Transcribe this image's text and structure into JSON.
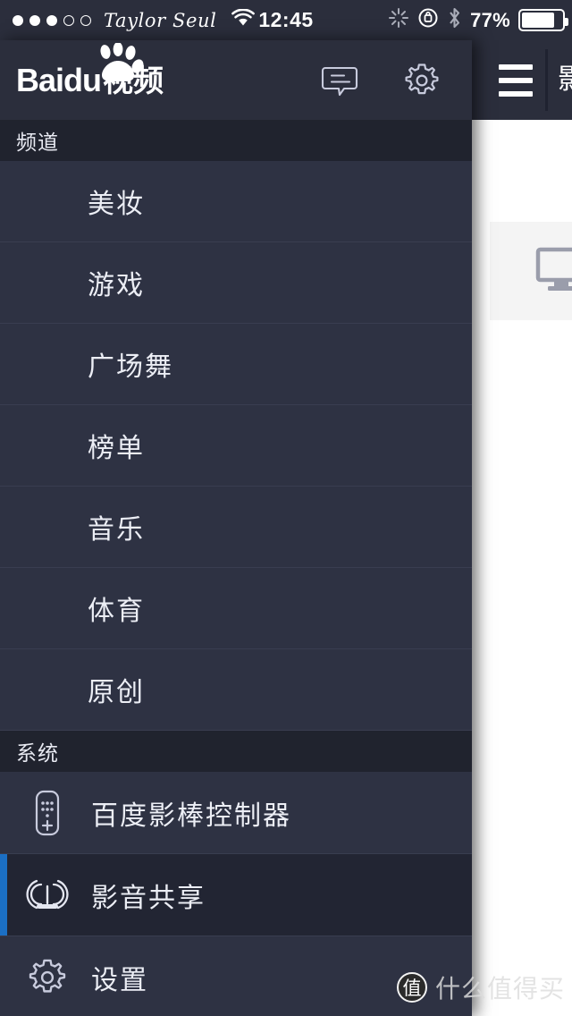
{
  "status_bar": {
    "signal_dots_filled": 3,
    "signal_dots_total": 5,
    "carrier": "Taylor Seul",
    "wifi_icon": "wifi-icon",
    "time": "12:45",
    "sync_icon": "sync-spinner-icon",
    "rotation_lock_icon": "rotation-lock-icon",
    "bluetooth_icon": "bluetooth-icon",
    "battery_percent": "77%"
  },
  "drawer": {
    "logo": {
      "brand": "Bai",
      "brand_suffix": "du",
      "brand_cn": "视频",
      "paw_icon": "baidu-paw-icon"
    },
    "header_icons": [
      {
        "name": "message-icon",
        "label": "消息"
      },
      {
        "name": "gear-icon",
        "label": "设置"
      }
    ],
    "sections": [
      {
        "title": "频道",
        "items": [
          {
            "label": "美妆"
          },
          {
            "label": "游戏"
          },
          {
            "label": "广场舞"
          },
          {
            "label": "榜单"
          },
          {
            "label": "音乐"
          },
          {
            "label": "体育"
          },
          {
            "label": "原创"
          }
        ]
      },
      {
        "title": "系统",
        "items": [
          {
            "label": "百度影棒控制器",
            "icon": "remote-control-icon",
            "selected": false
          },
          {
            "label": "影音共享",
            "icon": "cast-broadcast-icon",
            "selected": true
          },
          {
            "label": "设置",
            "icon": "gear-icon",
            "selected": false
          }
        ]
      }
    ]
  },
  "content": {
    "menu_icon": "hamburger-menu-icon",
    "title": "影音共享",
    "placeholder_icon": "monitor-icon"
  },
  "watermark": {
    "badge": "值",
    "text": "什么值得买"
  },
  "colors": {
    "drawer_bg": "#2e3243",
    "section_bg": "#20232e",
    "header_bg": "#2b2e3c",
    "selected_bg": "#222533",
    "accent_blue": "#1b6fc4",
    "text": "#eceef5",
    "divider": "#393d50",
    "card_bg": "#f4f4f4",
    "icon_gray": "#9a9dab"
  }
}
